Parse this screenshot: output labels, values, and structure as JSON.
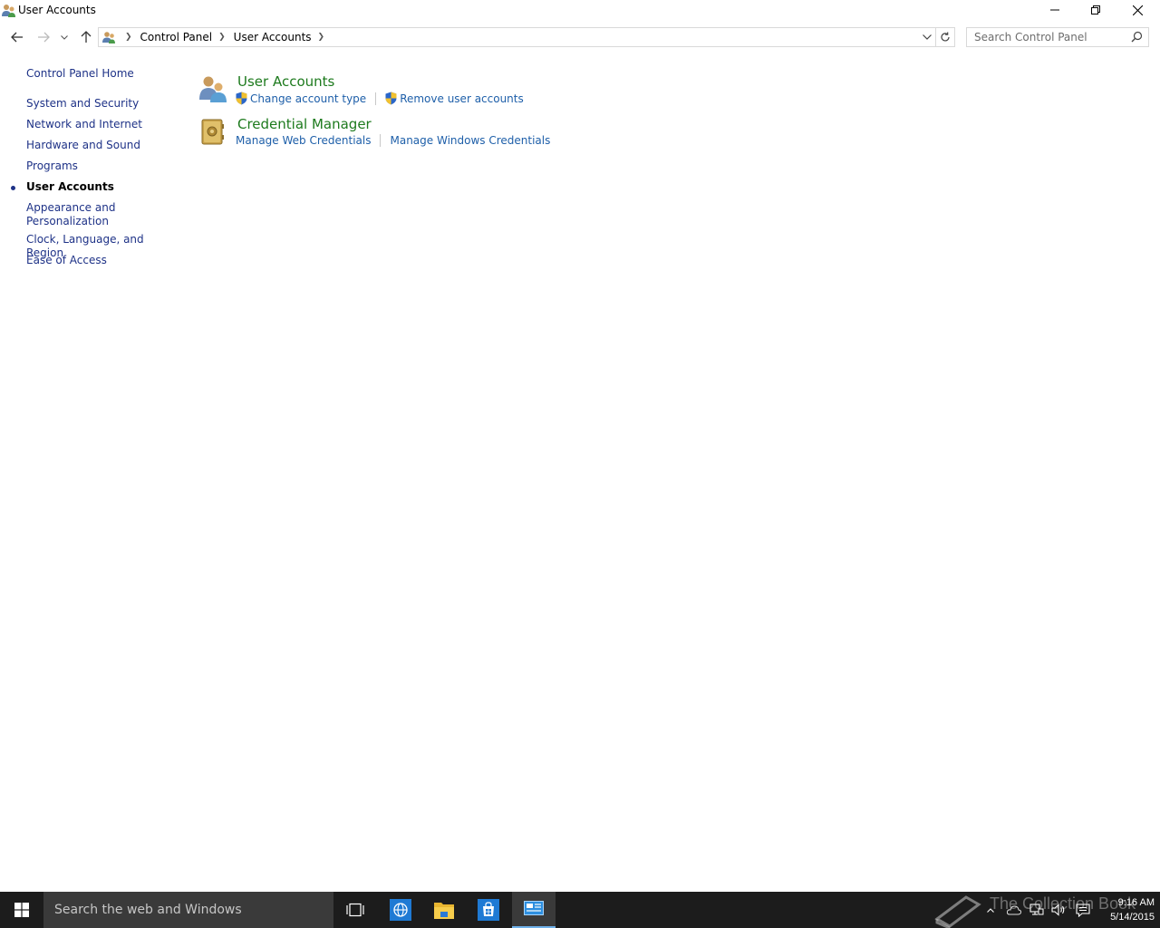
{
  "window": {
    "title": "User Accounts"
  },
  "address": {
    "crumbs": [
      "Control Panel",
      "User Accounts"
    ]
  },
  "search": {
    "placeholder": "Search Control Panel"
  },
  "left_nav": {
    "home": "Control Panel Home",
    "items": [
      "System and Security",
      "Network and Internet",
      "Hardware and Sound",
      "Programs",
      "User Accounts",
      "Appearance and Personalization",
      "Clock, Language, and Region",
      "Ease of Access"
    ],
    "current": "User Accounts"
  },
  "main": {
    "categories": [
      {
        "title": "User Accounts",
        "icon": "users-icon",
        "links": [
          "Change account type",
          "Remove user accounts"
        ]
      },
      {
        "title": "Credential Manager",
        "icon": "vault-icon",
        "links": [
          "Manage Web Credentials",
          "Manage Windows Credentials"
        ]
      }
    ]
  },
  "taskbar": {
    "search_placeholder": "Search the web and Windows",
    "time": "9:16 AM",
    "date": "5/14/2015",
    "watermark": "The Collection Book"
  },
  "colors": {
    "link_blue": "#1e5fa9",
    "nav_blue": "#1e3287",
    "category_green": "#1d7a1d",
    "taskbar_bg": "#1c1c1c",
    "accent": "#6fb1ea"
  }
}
